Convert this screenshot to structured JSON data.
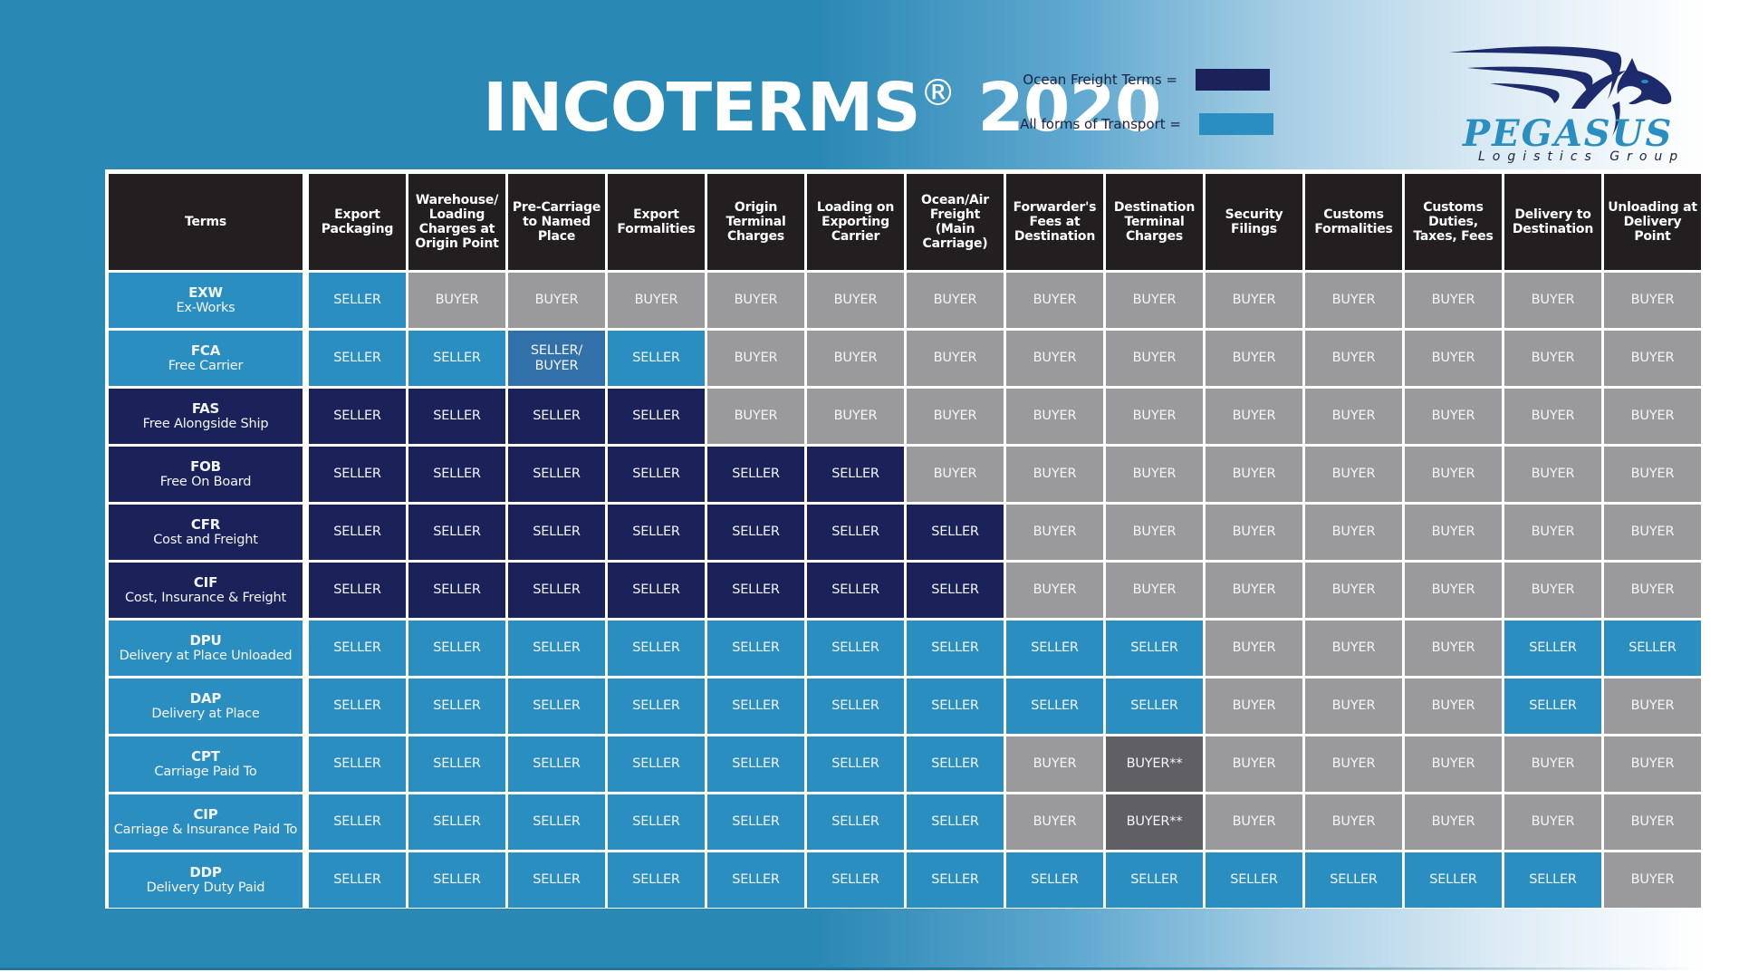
{
  "title": {
    "main": "INCOTERMS",
    "reg": "®",
    "year": "2020"
  },
  "legend": [
    {
      "label": "Ocean Freight Terms =",
      "color": "#1b2159"
    },
    {
      "label": "All forms of Transport =",
      "color": "#2a8ec0"
    }
  ],
  "logo": {
    "icon": "pegasus-winged-horse-icon",
    "name": "PEGASUS",
    "tagline": "Logistics Group"
  },
  "colors": {
    "ocean": "#1b2159",
    "all_transport": "#2a8ec0",
    "shared": "#3270aa",
    "buyer": "#9a9a9c",
    "buyer_note": "#5f5f64",
    "header": "#231f20",
    "background": "#2a88b5"
  },
  "table": {
    "headers": [
      "Terms",
      "Export Packaging",
      "Warehouse/ Loading Charges at Origin Point",
      "Pre-Carriage to Named Place",
      "Export Formalities",
      "Origin Terminal Charges",
      "Loading on Exporting Carrier",
      "Ocean/Air Freight (Main Carriage)",
      "Forwarder's Fees at Destination",
      "Destination Terminal Charges",
      "Security Filings",
      "Customs Formalities",
      "Customs Duties, Taxes, Fees",
      "Delivery to Destination",
      "Unloading at Delivery Point"
    ],
    "rows": [
      {
        "code": "EXW",
        "name": "Ex-Works",
        "category": "all",
        "cells": [
          "SELLER",
          "BUYER",
          "BUYER",
          "BUYER",
          "BUYER",
          "BUYER",
          "BUYER",
          "BUYER",
          "BUYER",
          "BUYER",
          "BUYER",
          "BUYER",
          "BUYER",
          "BUYER"
        ]
      },
      {
        "code": "FCA",
        "name": "Free Carrier",
        "category": "all",
        "cells": [
          "SELLER",
          "SELLER",
          "SELLER/ BUYER",
          "SELLER",
          "BUYER",
          "BUYER",
          "BUYER",
          "BUYER",
          "BUYER",
          "BUYER",
          "BUYER",
          "BUYER",
          "BUYER",
          "BUYER"
        ]
      },
      {
        "code": "FAS",
        "name": "Free Alongside Ship",
        "category": "ocean",
        "cells": [
          "SELLER",
          "SELLER",
          "SELLER",
          "SELLER",
          "BUYER",
          "BUYER",
          "BUYER",
          "BUYER",
          "BUYER",
          "BUYER",
          "BUYER",
          "BUYER",
          "BUYER",
          "BUYER"
        ]
      },
      {
        "code": "FOB",
        "name": "Free On Board",
        "category": "ocean",
        "cells": [
          "SELLER",
          "SELLER",
          "SELLER",
          "SELLER",
          "SELLER",
          "SELLER",
          "BUYER",
          "BUYER",
          "BUYER",
          "BUYER",
          "BUYER",
          "BUYER",
          "BUYER",
          "BUYER"
        ]
      },
      {
        "code": "CFR",
        "name": "Cost and Freight",
        "category": "ocean",
        "cells": [
          "SELLER",
          "SELLER",
          "SELLER",
          "SELLER",
          "SELLER",
          "SELLER",
          "SELLER",
          "BUYER",
          "BUYER",
          "BUYER",
          "BUYER",
          "BUYER",
          "BUYER",
          "BUYER"
        ]
      },
      {
        "code": "CIF",
        "name": "Cost, Insurance & Freight",
        "category": "ocean",
        "cells": [
          "SELLER",
          "SELLER",
          "SELLER",
          "SELLER",
          "SELLER",
          "SELLER",
          "SELLER",
          "BUYER",
          "BUYER",
          "BUYER",
          "BUYER",
          "BUYER",
          "BUYER",
          "BUYER"
        ]
      },
      {
        "code": "DPU",
        "name": "Delivery at Place Unloaded",
        "category": "all",
        "cells": [
          "SELLER",
          "SELLER",
          "SELLER",
          "SELLER",
          "SELLER",
          "SELLER",
          "SELLER",
          "SELLER",
          "SELLER",
          "BUYER",
          "BUYER",
          "BUYER",
          "SELLER",
          "SELLER"
        ]
      },
      {
        "code": "DAP",
        "name": "Delivery at Place",
        "category": "all",
        "cells": [
          "SELLER",
          "SELLER",
          "SELLER",
          "SELLER",
          "SELLER",
          "SELLER",
          "SELLER",
          "SELLER",
          "SELLER",
          "BUYER",
          "BUYER",
          "BUYER",
          "SELLER",
          "BUYER"
        ]
      },
      {
        "code": "CPT",
        "name": "Carriage Paid To",
        "category": "all",
        "cells": [
          "SELLER",
          "SELLER",
          "SELLER",
          "SELLER",
          "SELLER",
          "SELLER",
          "SELLER",
          "BUYER",
          "BUYER**",
          "BUYER",
          "BUYER",
          "BUYER",
          "BUYER",
          "BUYER"
        ]
      },
      {
        "code": "CIP",
        "name": "Carriage & Insurance Paid To",
        "category": "all",
        "cells": [
          "SELLER",
          "SELLER",
          "SELLER",
          "SELLER",
          "SELLER",
          "SELLER",
          "SELLER",
          "BUYER",
          "BUYER**",
          "BUYER",
          "BUYER",
          "BUYER",
          "BUYER",
          "BUYER"
        ]
      },
      {
        "code": "DDP",
        "name": "Delivery Duty Paid",
        "category": "all",
        "cells": [
          "SELLER",
          "SELLER",
          "SELLER",
          "SELLER",
          "SELLER",
          "SELLER",
          "SELLER",
          "SELLER",
          "SELLER",
          "SELLER",
          "SELLER",
          "SELLER",
          "SELLER",
          "BUYER"
        ]
      }
    ]
  }
}
